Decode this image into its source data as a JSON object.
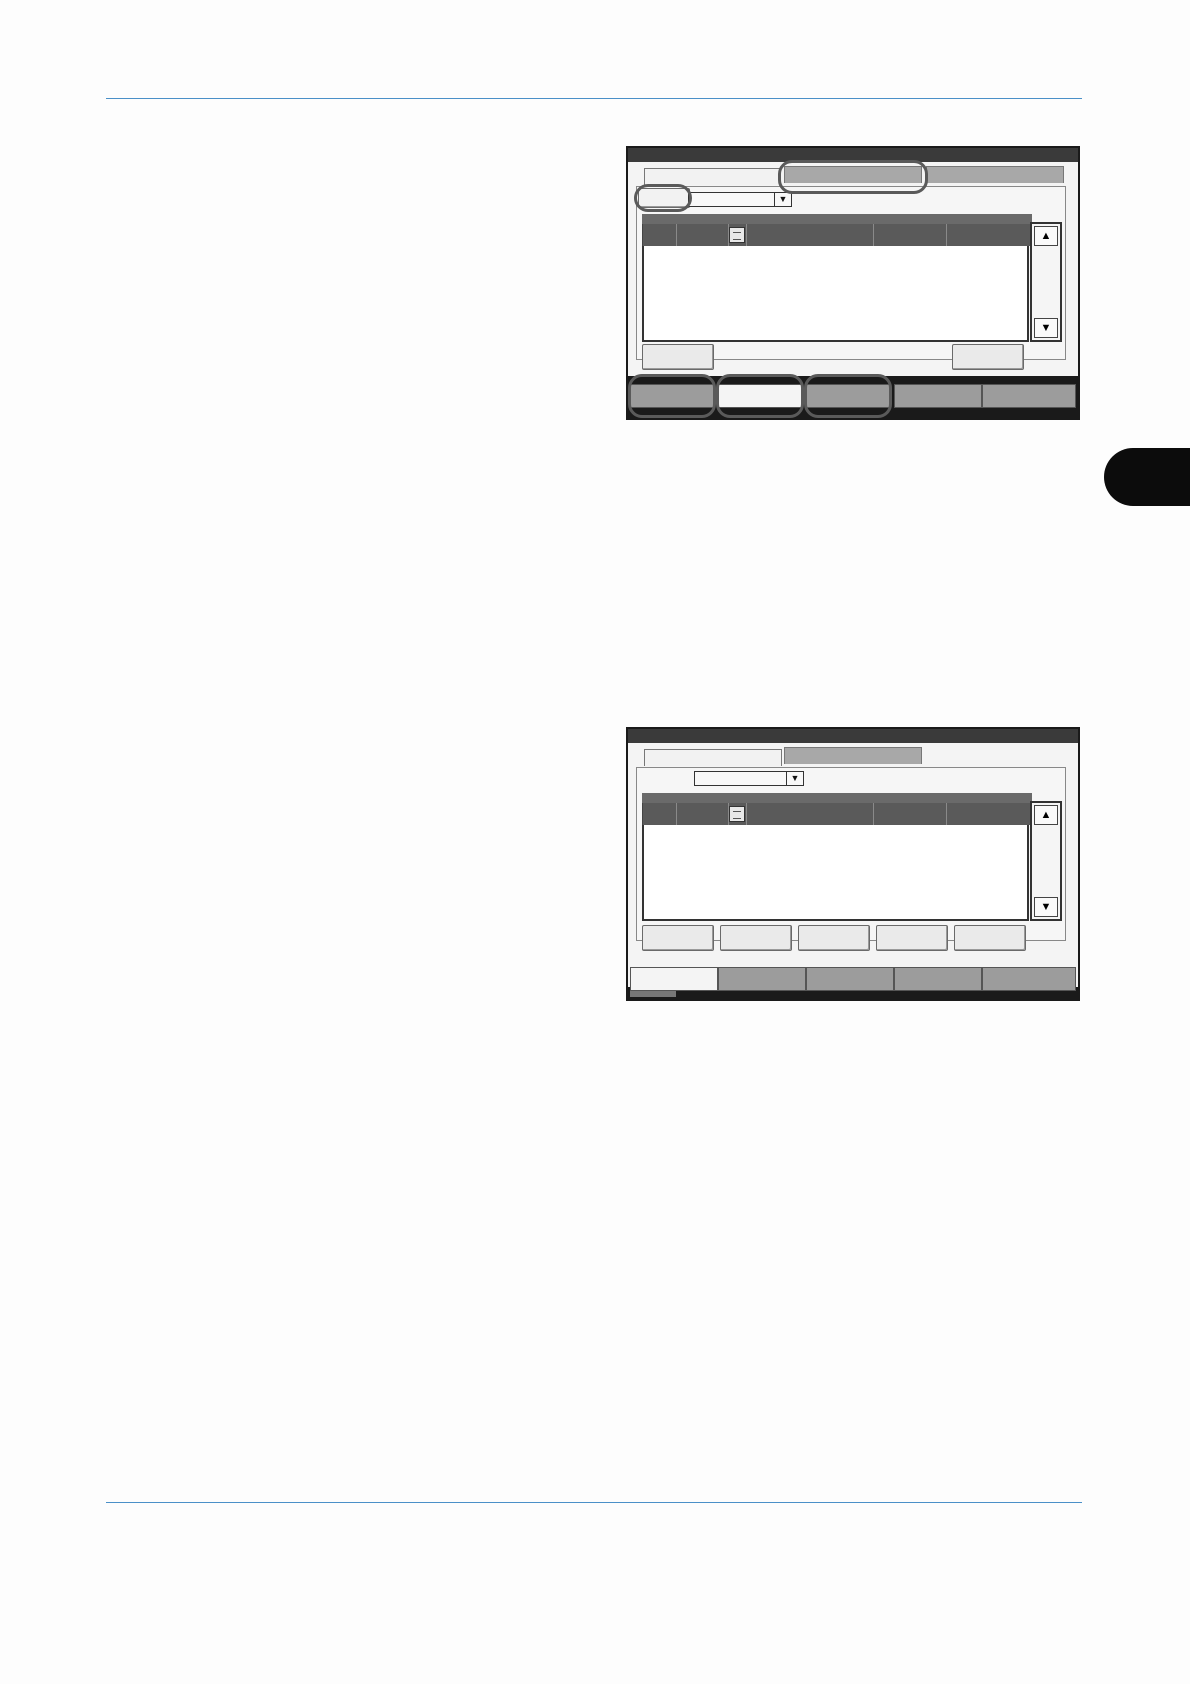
{
  "figure_1": {
    "scroll_up_label": "▲",
    "scroll_down_label": "▼",
    "dropdown_arrow": "▼"
  },
  "figure_2": {
    "scroll_up_label": "▲",
    "scroll_down_label": "▼",
    "dropdown_arrow": "▼"
  },
  "colors": {
    "rule": "#4a90c8",
    "side_tab": "#0c0c0c",
    "title_bar": "#3a3a3a"
  }
}
